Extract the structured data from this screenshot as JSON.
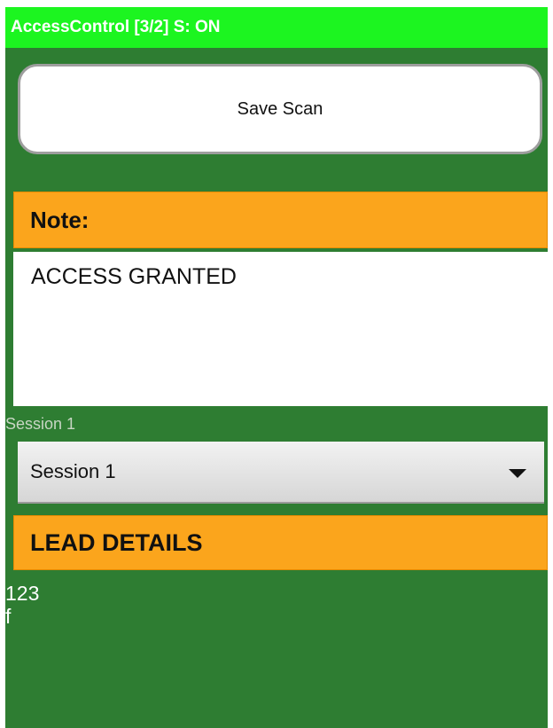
{
  "titlebar": {
    "title": "AccessControl [3/2] S: ON"
  },
  "actions": {
    "save_label": "Save Scan"
  },
  "note": {
    "header": "Note:",
    "text": "ACCESS GRANTED"
  },
  "session": {
    "label": "Session 1",
    "selected": "Session 1"
  },
  "lead": {
    "header": "LEAD DETAILS",
    "lines": [
      "123",
      "f"
    ]
  },
  "colors": {
    "titlebar": "#1cf520",
    "background": "#2e7d32",
    "section_header": "#fba51c"
  }
}
